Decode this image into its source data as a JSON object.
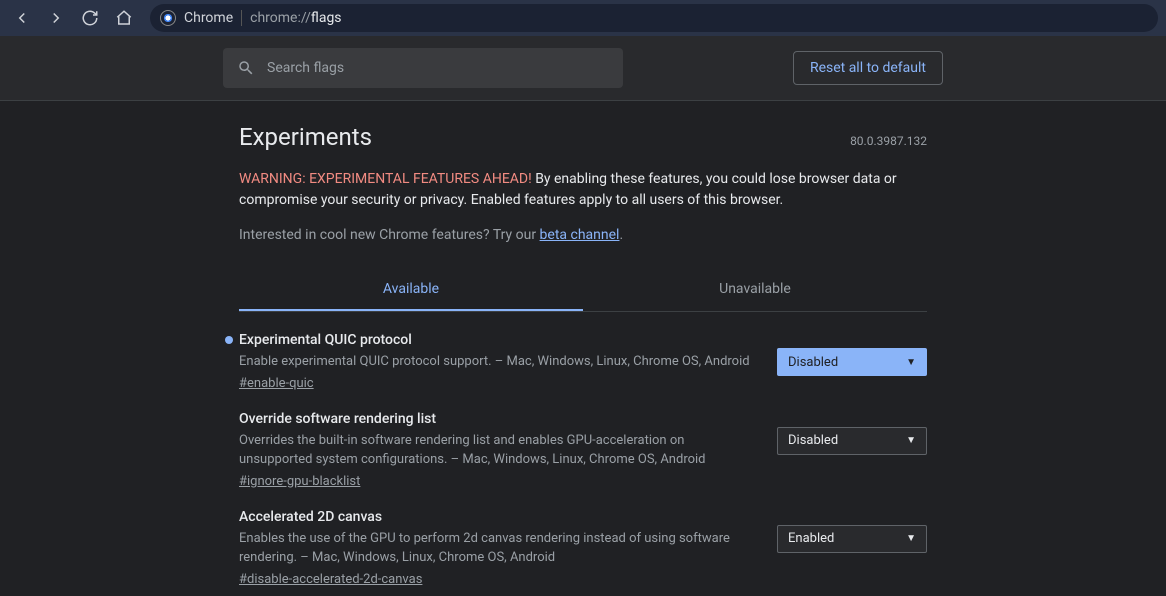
{
  "urlbar": {
    "browser_label": "Chrome",
    "full": "chrome://flags",
    "prefix": "chrome://",
    "highlight": "flags"
  },
  "search": {
    "placeholder": "Search flags"
  },
  "reset_label": "Reset all to default",
  "title": "Experiments",
  "version": "80.0.3987.132",
  "warning": {
    "prefix": "WARNING: EXPERIMENTAL FEATURES AHEAD!",
    "text": " By enabling these features, you could lose browser data or compromise your security or privacy. Enabled features apply to all users of this browser."
  },
  "beta": {
    "text": "Interested in cool new Chrome features? Try our ",
    "link": "beta channel",
    "suffix": "."
  },
  "tabs": {
    "available": "Available",
    "unavailable": "Unavailable"
  },
  "flags": [
    {
      "title": "Experimental QUIC protocol",
      "desc": "Enable experimental QUIC protocol support. – Mac, Windows, Linux, Chrome OS, Android",
      "hash": "#enable-quic",
      "value": "Disabled",
      "highlighted": true,
      "modified": true
    },
    {
      "title": "Override software rendering list",
      "desc": "Overrides the built-in software rendering list and enables GPU-acceleration on unsupported system configurations. – Mac, Windows, Linux, Chrome OS, Android",
      "hash": "#ignore-gpu-blacklist",
      "value": "Disabled",
      "highlighted": false,
      "modified": false
    },
    {
      "title": "Accelerated 2D canvas",
      "desc": "Enables the use of the GPU to perform 2d canvas rendering instead of using software rendering. – Mac, Windows, Linux, Chrome OS, Android",
      "hash": "#disable-accelerated-2d-canvas",
      "value": "Enabled",
      "highlighted": false,
      "modified": false
    }
  ]
}
